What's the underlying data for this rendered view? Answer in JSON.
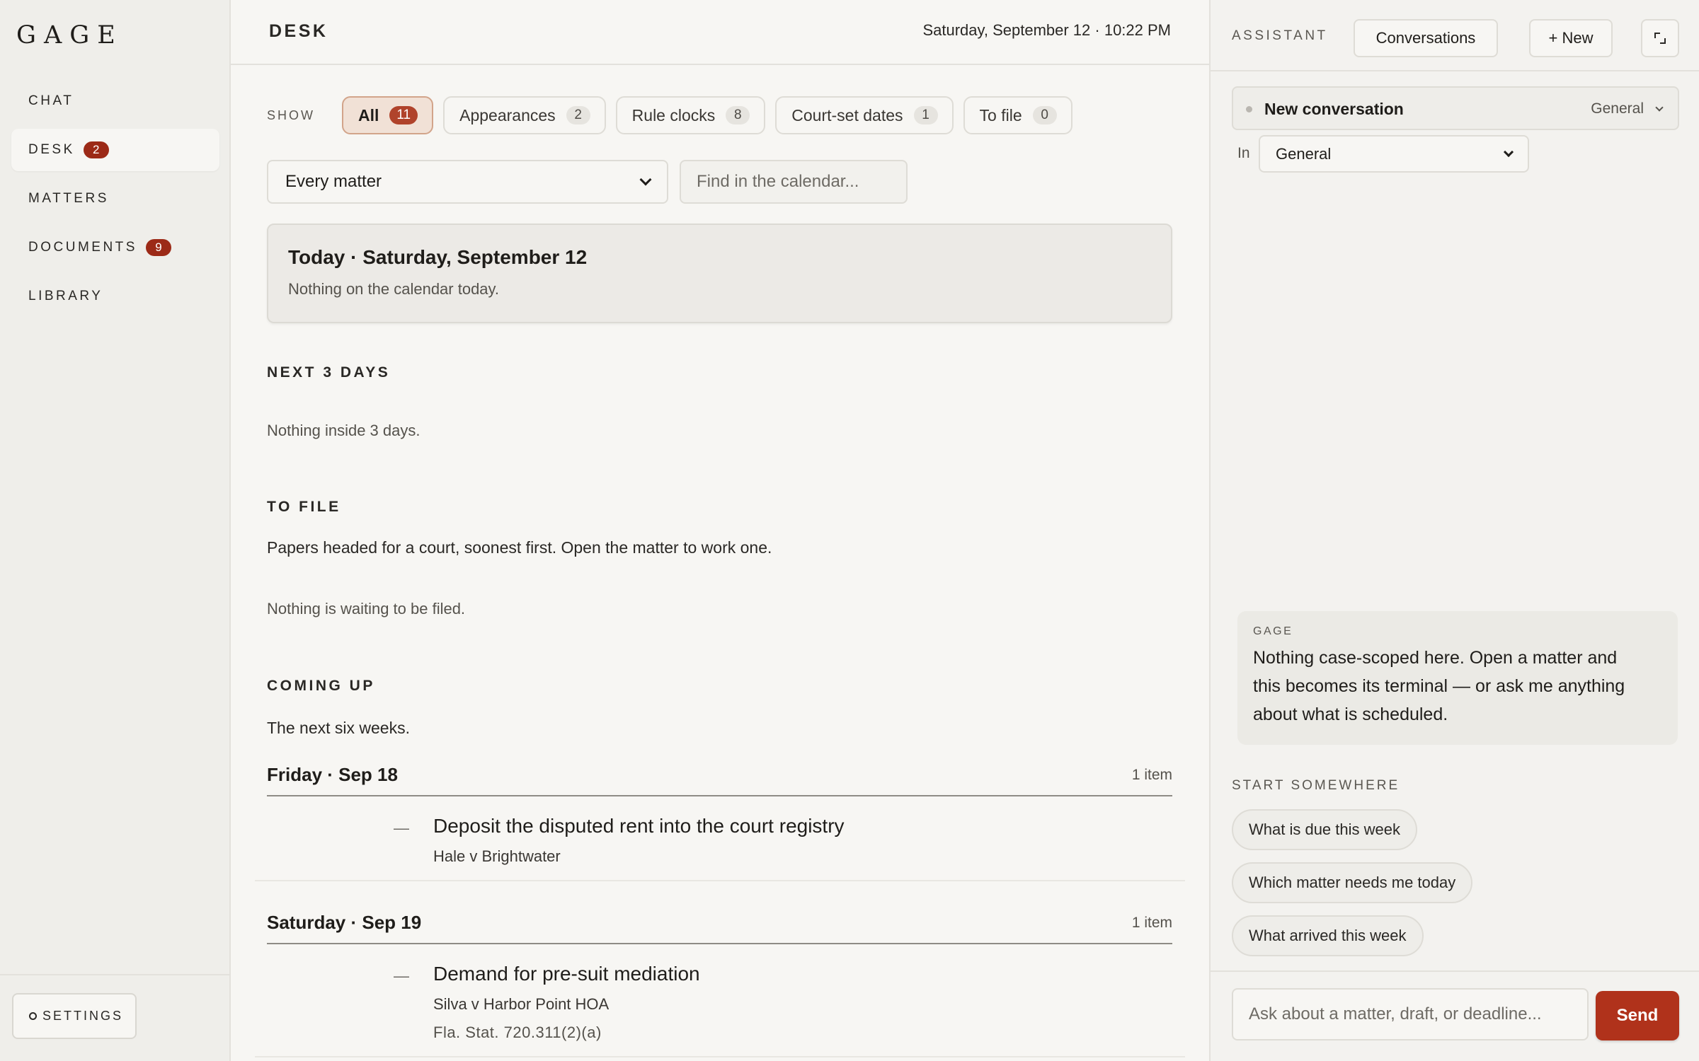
{
  "sidebar": {
    "logo": "GAGE",
    "items": [
      {
        "label": "CHAT",
        "badge": null
      },
      {
        "label": "DESK",
        "badge": "2"
      },
      {
        "label": "MATTERS",
        "badge": null
      },
      {
        "label": "DOCUMENTS",
        "badge": "9"
      },
      {
        "label": "LIBRARY",
        "badge": null
      }
    ],
    "active_item": "DESK",
    "settings_label": "SETTINGS"
  },
  "header": {
    "title": "DESK",
    "datetime": "Saturday, September 12 · 10:22 PM"
  },
  "filters": {
    "show_label": "SHOW",
    "pills": [
      {
        "label": "All",
        "count": "11",
        "active": true
      },
      {
        "label": "Appearances",
        "count": "2",
        "active": false
      },
      {
        "label": "Rule clocks",
        "count": "8",
        "active": false
      },
      {
        "label": "Court-set dates",
        "count": "1",
        "active": false
      },
      {
        "label": "To file",
        "count": "0",
        "active": false
      }
    ],
    "matter_select": "Every matter",
    "search_placeholder": "Find in the calendar..."
  },
  "today": {
    "title": "Today · Saturday, September 12",
    "subtitle": "Nothing on the calendar today."
  },
  "next_days": {
    "heading": "NEXT 3 DAYS",
    "empty": "Nothing inside 3 days."
  },
  "to_file": {
    "heading": "TO FILE",
    "description": "Papers headed for a court, soonest first. Open the matter to work one.",
    "empty": "Nothing is waiting to be filed."
  },
  "coming_up": {
    "heading": "COMING UP",
    "description": "The next six weeks.",
    "days": [
      {
        "name": "Friday · Sep 18",
        "count": "1 item",
        "events": [
          {
            "dash": "—",
            "title": "Deposit the disputed rent into the court registry",
            "matter": "Hale v Brightwater",
            "cite": ""
          }
        ]
      },
      {
        "name": "Saturday · Sep 19",
        "count": "1 item",
        "events": [
          {
            "dash": "—",
            "title": "Demand for pre-suit mediation",
            "matter": "Silva v Harbor Point HOA",
            "cite": "Fla. Stat. 720.311(2)(a)"
          }
        ]
      }
    ]
  },
  "assistant": {
    "label": "ASSISTANT",
    "conversations_button": "Conversations",
    "new_button": "+ New",
    "conversation_title": "New conversation",
    "conversation_scope": "General",
    "in_label": "In",
    "in_select": "General",
    "message": {
      "author": "GAGE",
      "text": "Nothing case-scoped here. Open a matter and this becomes its terminal — or ask me anything about what is scheduled."
    },
    "start_label": "START SOMEWHERE",
    "suggestions": [
      "What is due this week",
      "Which matter needs me today",
      "What arrived this week"
    ],
    "compose_placeholder": "Ask about a matter, draft, or deadline...",
    "send_label": "Send"
  },
  "colors": {
    "accent": "#b0321b",
    "badge": "#9c2a17",
    "background": "#f7f6f3",
    "sidebar": "#efeeea"
  }
}
